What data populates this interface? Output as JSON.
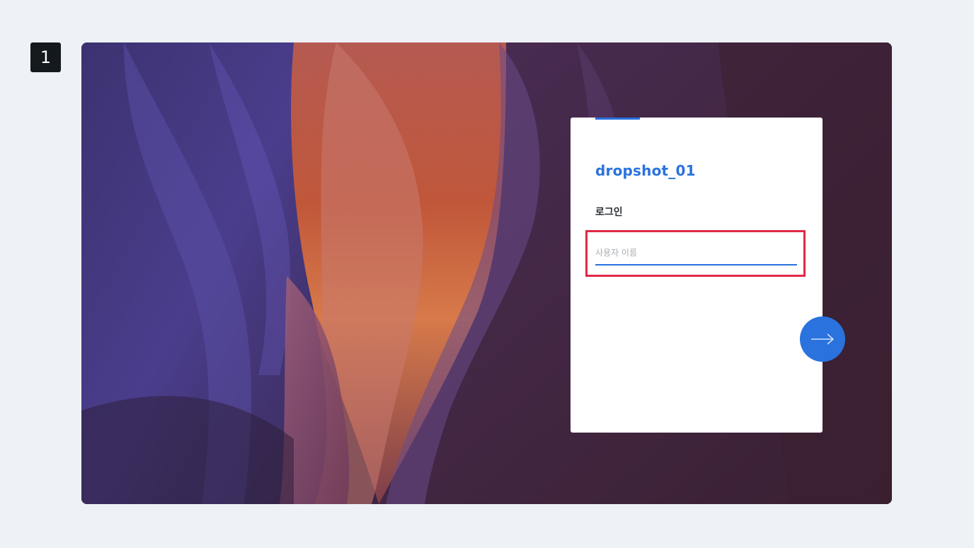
{
  "step": {
    "number": "1"
  },
  "login_card": {
    "app_name": "dropshot_01",
    "title": "로그인",
    "username_placeholder": "사용자 이름",
    "username_value": ""
  },
  "next_button": {
    "icon": "arrow-right-icon"
  },
  "colors": {
    "accent": "#2a72de",
    "highlight": "#e02a45",
    "page_background": "#eef2f6",
    "badge": "#14191e"
  }
}
